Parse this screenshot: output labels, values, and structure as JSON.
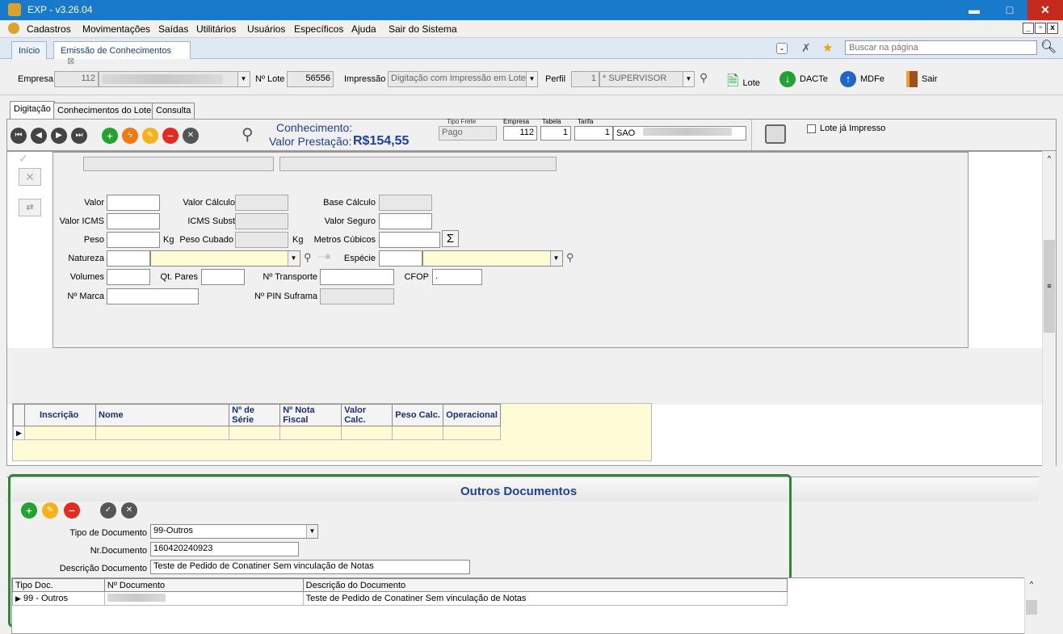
{
  "app": {
    "title": "EXP - v3.26.04",
    "controls": {
      "min": "▬",
      "max": "□",
      "close": "✕"
    }
  },
  "menu": [
    "Cadastros",
    "Movimentações",
    "Saídas",
    "Utilitários",
    "Usuários",
    "Específicos",
    "Ajuda",
    "Sair do Sistema"
  ],
  "mdi_controls": [
    "_",
    "▫",
    "x"
  ],
  "tabs": {
    "home": "Início",
    "active": "Emissão de Conhecimentos",
    "close": "⊠"
  },
  "search": {
    "placeholder": "Buscar na página"
  },
  "header": {
    "empresa_label": "Empresa",
    "empresa_code": "112",
    "lote_label": "Nº Lote",
    "lote_value": "56556",
    "impressao_label": "Impressão",
    "impressao_value": "Digitação com Impressão em Lote",
    "perfil_label": "Perfil",
    "perfil_code": "1",
    "perfil_value": "* SUPERVISOR",
    "btn_lote": "Lote",
    "btn_dacte": "DACTe",
    "btn_mdfe": "MDFe",
    "btn_sair": "Sair"
  },
  "subtabs": [
    "Digitação",
    "Conhecimentos do Lote",
    "Consulta"
  ],
  "toolbar": {
    "conhecimento_label": "Conhecimento:",
    "valor_prestacao_label": "Valor Prestação:",
    "valor_prestacao": "R$154,55",
    "tipo_frete_label": "Tipo Frete",
    "tipo_frete": "Pago",
    "empresa_label": "Empresa",
    "empresa": "112",
    "tabela_label": "Tabela",
    "tabela": "1",
    "tarifa_label": "Tarifa",
    "tarifa_code": "1",
    "tarifa_city": "SAO",
    "lote_impresso": "Lote já Impresso"
  },
  "form": {
    "valor": "Valor",
    "valor_calculo": "Valor Cálculo",
    "base_calculo": "Base Cálculo",
    "valor_icms": "Valor ICMS",
    "icms_subst": "ICMS Subst",
    "valor_seguro": "Valor Seguro",
    "peso": "Peso",
    "kg1": "Kg",
    "peso_cubado": "Peso Cubado",
    "kg2": "Kg",
    "metros_cubicos": "Metros Cúbicos",
    "sigma": "Σ",
    "natureza": "Natureza",
    "especie": "Espécie",
    "volumes": "Volumes",
    "qt_pares": "Qt. Pares",
    "n_transporte": "Nº Transporte",
    "cfop": "CFOP",
    "cfop_value": ".",
    "n_marca": "Nº Marca",
    "n_pin": "Nº PIN Suframa"
  },
  "nf_grid": {
    "columns": [
      "Inscrição",
      "Nome",
      "Nº de Série",
      "Nº Nota Fiscal",
      "Valor Calc.",
      "Peso Calc.",
      "Operacional"
    ]
  },
  "outros": {
    "title": "Outros Documentos",
    "tipo_label": "Tipo de Documento",
    "tipo_value": "99-Outros",
    "nr_label": "Nr.Documento",
    "nr_value": "160420240923",
    "desc_label": "Descrição Documento",
    "desc_value": "Teste de Pedido de Conatiner Sem vinculação de Notas",
    "columns": [
      "Tipo Doc.",
      "Nº Documento",
      "Descrição do Documento"
    ],
    "rows": [
      {
        "tipo": "99 - Outros",
        "descricao": "Teste de Pedido de Conatiner Sem vinculação de Notas"
      }
    ]
  }
}
